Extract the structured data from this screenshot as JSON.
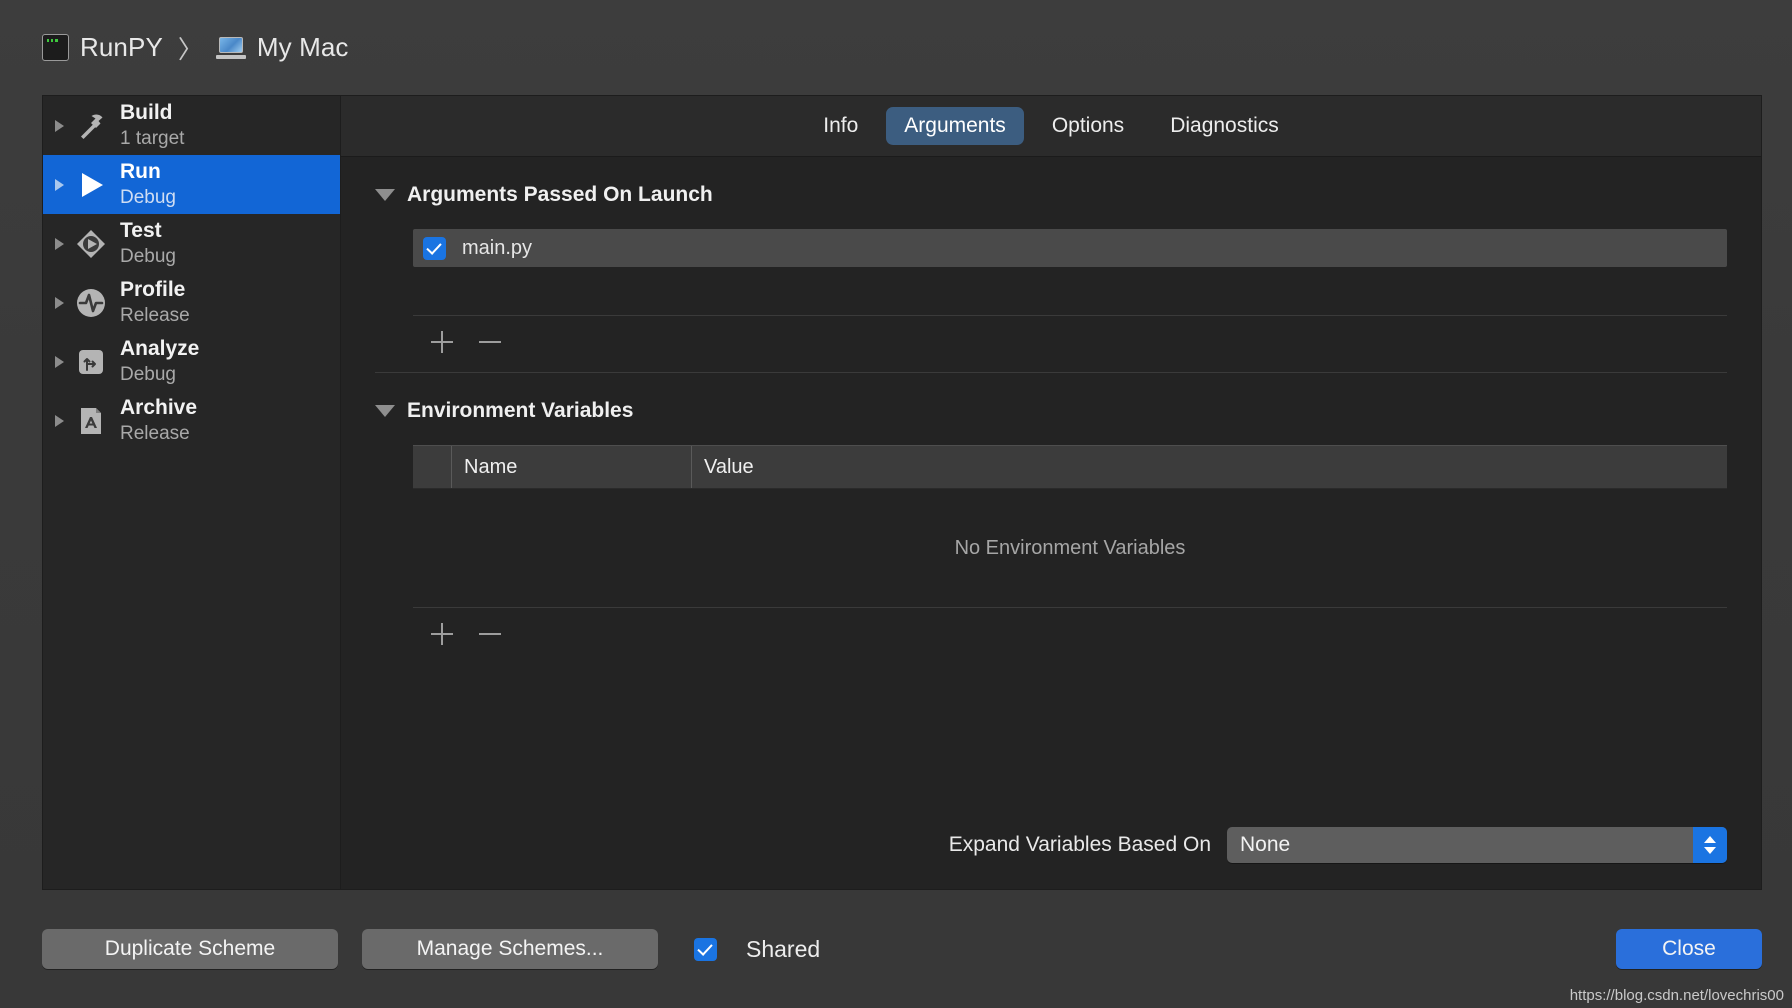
{
  "breadcrumb": {
    "scheme_icon": "scheme-icon",
    "scheme": "RunPY",
    "separator": "〉",
    "destination_icon": "mac-laptop-icon",
    "destination": "My Mac"
  },
  "sidebar": {
    "items": [
      {
        "title": "Build",
        "subtitle": "1 target",
        "icon": "hammer-icon",
        "selected": false
      },
      {
        "title": "Run",
        "subtitle": "Debug",
        "icon": "play-icon",
        "selected": true
      },
      {
        "title": "Test",
        "subtitle": "Debug",
        "icon": "test-diamond-icon",
        "selected": false
      },
      {
        "title": "Profile",
        "subtitle": "Release",
        "icon": "pulse-icon",
        "selected": false
      },
      {
        "title": "Analyze",
        "subtitle": "Debug",
        "icon": "analyze-arrows-icon",
        "selected": false
      },
      {
        "title": "Archive",
        "subtitle": "Release",
        "icon": "archive-document-icon",
        "selected": false
      }
    ],
    "selected_color": "#1266d6"
  },
  "tabs": [
    {
      "label": "Info",
      "active": false
    },
    {
      "label": "Arguments",
      "active": true
    },
    {
      "label": "Options",
      "active": false
    },
    {
      "label": "Diagnostics",
      "active": false
    }
  ],
  "arguments_section": {
    "title": "Arguments Passed On Launch",
    "expanded": true,
    "items": [
      {
        "label": "main.py",
        "checked": true
      }
    ],
    "add_icon": "plus-icon",
    "remove_icon": "minus-icon"
  },
  "environment_section": {
    "title": "Environment Variables",
    "expanded": true,
    "columns": [
      "Name",
      "Value"
    ],
    "rows": [],
    "empty_text": "No Environment Variables",
    "add_icon": "plus-icon",
    "remove_icon": "minus-icon"
  },
  "expand_variables": {
    "label": "Expand Variables Based On",
    "value": "None",
    "stepper_icon": "chevron-up-down-icon",
    "accent_color": "#1a74e2"
  },
  "footer": {
    "duplicate_scheme": "Duplicate Scheme",
    "manage_schemes": "Manage Schemes...",
    "shared_label": "Shared",
    "shared_checked": true,
    "close": "Close",
    "close_color": "#2a6fdb"
  },
  "watermark": "https://blog.csdn.net/lovechris00"
}
